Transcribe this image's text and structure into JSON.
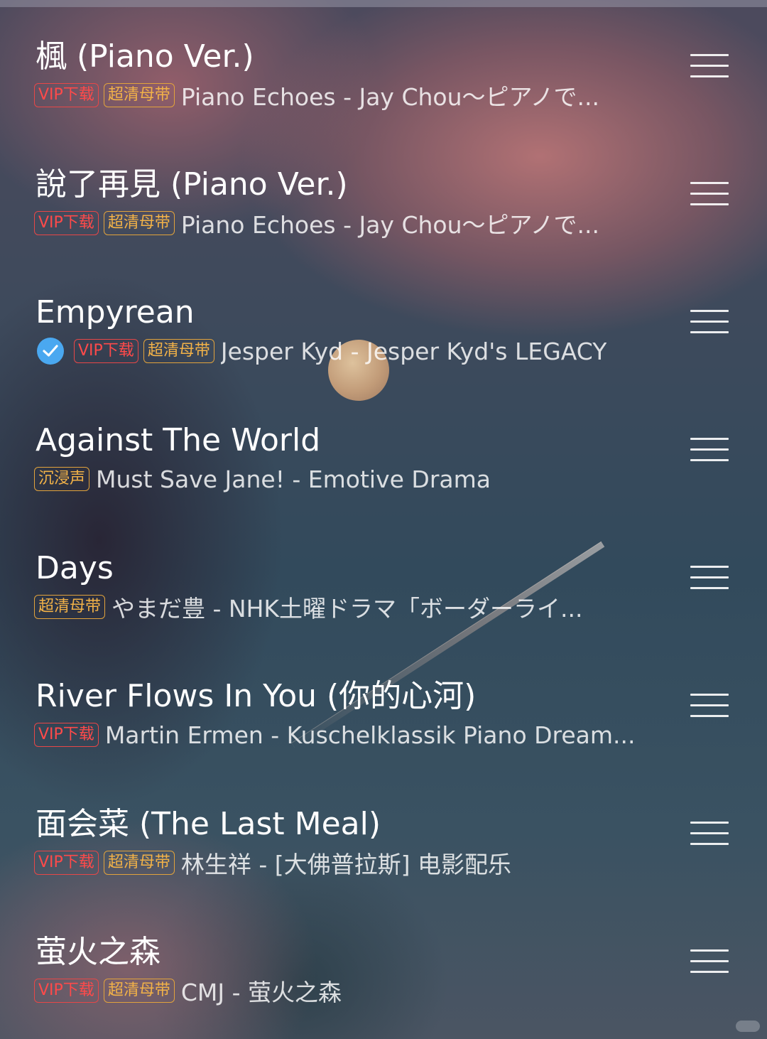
{
  "tags": {
    "vip": "VIP下载",
    "hq": "超清母带",
    "immersive": "沉浸声"
  },
  "colors": {
    "vip_tag": "#ff4a4a",
    "hq_tag": "#f2b248",
    "check": "#4aa8f0"
  },
  "songs": [
    {
      "title": "楓 (Piano Ver.)",
      "artist_album": "Piano Echoes - Jay Chou～ピアノで...",
      "vip": true,
      "hq": true,
      "immersive": false,
      "downloaded": false
    },
    {
      "title": "說了再見 (Piano Ver.)",
      "artist_album": "Piano Echoes - Jay Chou～ピアノで...",
      "vip": true,
      "hq": true,
      "immersive": false,
      "downloaded": false
    },
    {
      "title": "Empyrean",
      "artist_album": "Jesper Kyd - Jesper Kyd's LEGACY",
      "vip": true,
      "hq": true,
      "immersive": false,
      "downloaded": true
    },
    {
      "title": "Against The World",
      "artist_album": "Must Save Jane! - Emotive Drama",
      "vip": false,
      "hq": false,
      "immersive": true,
      "downloaded": false
    },
    {
      "title": "Days",
      "artist_album": "やまだ豊 - NHK土曜ドラマ「ボーダーライ...",
      "vip": false,
      "hq": true,
      "immersive": false,
      "downloaded": false
    },
    {
      "title": "River Flows In You (你的心河)",
      "artist_album": "Martin Ermen - Kuschelklassik Piano Dream...",
      "vip": true,
      "hq": false,
      "immersive": false,
      "downloaded": false
    },
    {
      "title": "面会菜 (The Last Meal)",
      "artist_album": "林生祥 - [大佛普拉斯] 电影配乐",
      "vip": true,
      "hq": true,
      "immersive": false,
      "downloaded": false
    },
    {
      "title": "萤火之森",
      "artist_album": "CMJ - 萤火之森",
      "vip": true,
      "hq": true,
      "immersive": false,
      "downloaded": false
    }
  ],
  "icons": {
    "menu": "menu-icon",
    "downloaded": "check-circle-icon"
  }
}
